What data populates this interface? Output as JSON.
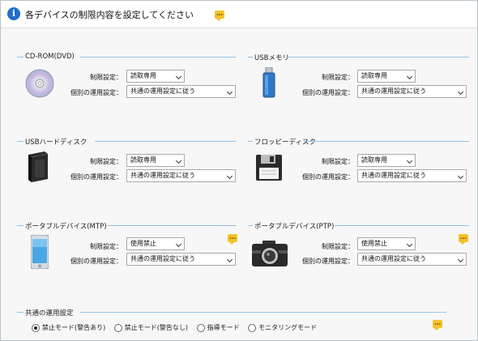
{
  "header": {
    "title": "各デバイスの制限内容を設定してください"
  },
  "labels": {
    "restriction": "制限設定：",
    "individual": "個別の運用設定："
  },
  "devices": [
    {
      "name": "CD-ROM(DVD)",
      "restriction": "読取専用",
      "individual": "共通の運用設定に従う",
      "icon": "cd-icon"
    },
    {
      "name": "USBメモリ",
      "restriction": "読取専用",
      "individual": "共通の運用設定に従う",
      "icon": "usb-stick-icon"
    },
    {
      "name": "USBハードディスク",
      "restriction": "読取専用",
      "individual": "共通の運用設定に従う",
      "icon": "hard-disk-icon"
    },
    {
      "name": "フロッピーディスク",
      "restriction": "読取専用",
      "individual": "共通の運用設定に従う",
      "icon": "floppy-icon"
    },
    {
      "name": "ポータブルデバイス(MTP)",
      "restriction": "使用禁止",
      "individual": "共通の運用設定に従う",
      "icon": "phone-icon"
    },
    {
      "name": "ポータブルデバイス(PTP)",
      "restriction": "使用禁止",
      "individual": "共通の運用設定に従う",
      "icon": "camera-icon"
    }
  ],
  "common": {
    "title": "共通の運用設定",
    "options": [
      {
        "label": "禁止モード(警告あり)",
        "selected": true
      },
      {
        "label": "禁止モード(警告なし)",
        "selected": false
      },
      {
        "label": "指導モード",
        "selected": false
      },
      {
        "label": "モニタリングモード",
        "selected": false
      }
    ]
  },
  "colors": {
    "accent_line": "#8fc3ea",
    "info": "#1e6fc9",
    "help": "#f4c32c"
  }
}
